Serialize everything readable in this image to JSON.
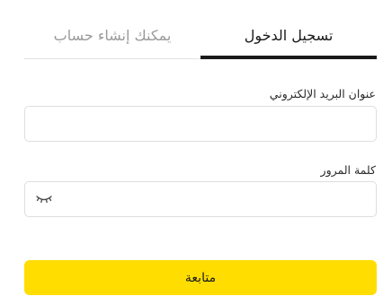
{
  "tabs": {
    "login": "تسجيل الدخول",
    "signup": "يمكنك إنشاء حساب"
  },
  "form": {
    "email_label": "عنوان البريد الإلكتروني",
    "email_value": "",
    "password_label": "كلمة المرور",
    "password_value": "",
    "submit_label": "متابعة"
  },
  "icons": {
    "password_toggle": "eye-closed-icon"
  },
  "colors": {
    "accent": "#ffdd00",
    "active_tab_underline": "#1a1a1a",
    "inactive_tab_text": "#9a9a9a"
  }
}
